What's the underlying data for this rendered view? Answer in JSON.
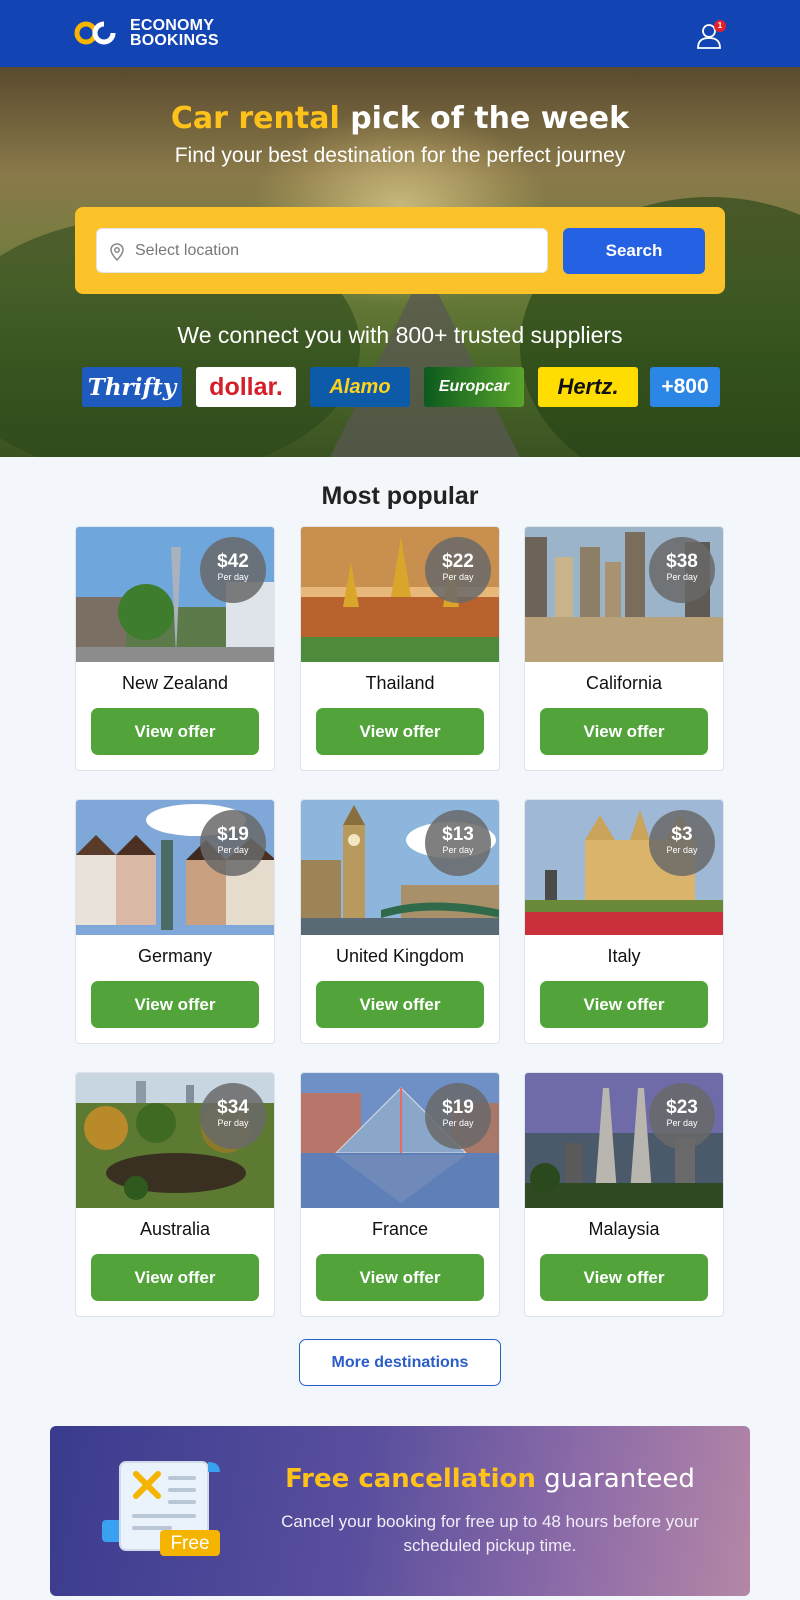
{
  "header": {
    "logo_line1": "ECONOMY",
    "logo_line2": "BOOKINGS",
    "notification_count": "1"
  },
  "hero": {
    "title_accent": "Car rental",
    "title_rest": " pick of the week",
    "subtitle": "Find your best destination for the perfect journey",
    "search": {
      "placeholder": "Select location",
      "value": "",
      "button_label": "Search"
    },
    "suppliers_text": "We connect you with 800+ trusted suppliers",
    "suppliers": [
      "Thrifty",
      "dollar.",
      "Alamo",
      "Europcar",
      "Hertz.",
      "+800"
    ]
  },
  "popular": {
    "title": "Most popular",
    "per_label": "Per day",
    "button_label": "View offer",
    "destinations": [
      {
        "name": "New Zealand",
        "price": "$42"
      },
      {
        "name": "Thailand",
        "price": "$22"
      },
      {
        "name": "California",
        "price": "$38"
      },
      {
        "name": "Germany",
        "price": "$19"
      },
      {
        "name": "United Kingdom",
        "price": "$13"
      },
      {
        "name": "Italy",
        "price": "$3"
      },
      {
        "name": "Australia",
        "price": "$34"
      },
      {
        "name": "France",
        "price": "$19"
      },
      {
        "name": "Malaysia",
        "price": "$23"
      }
    ],
    "more_label": "More destinations"
  },
  "cancellation": {
    "title_accent": "Free cancellation",
    "title_rest": " guaranteed",
    "text": "Cancel your booking for free up to 48 hours before your scheduled pickup time.",
    "badge": "Free"
  },
  "colors": {
    "header_bg": "#1344b3",
    "accent_yellow": "#fcc229",
    "search_button": "#2461e3",
    "offer_button": "#52a33a",
    "link_blue": "#2a5dc7"
  }
}
